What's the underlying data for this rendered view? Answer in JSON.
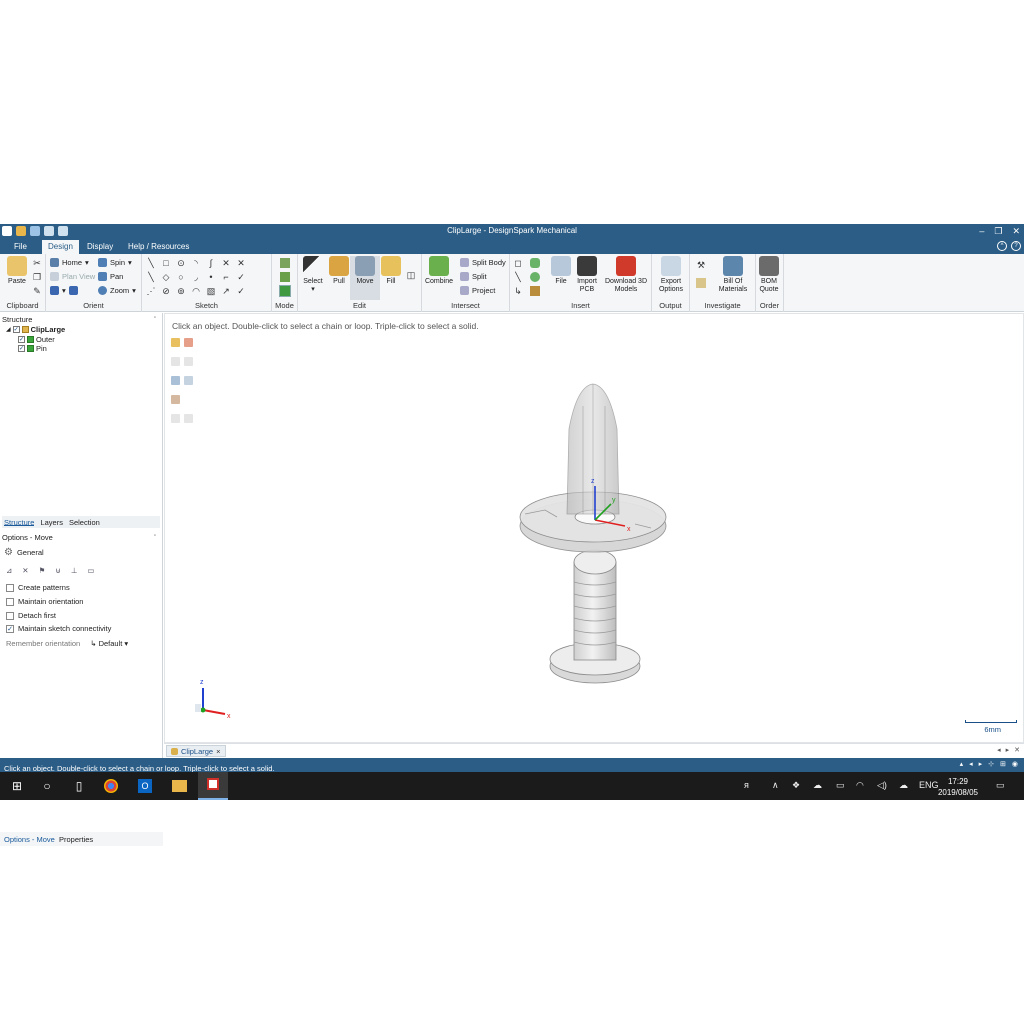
{
  "window": {
    "title": "ClipLarge - DesignSpark Mechanical",
    "controls": [
      "–",
      "❐",
      "✕"
    ]
  },
  "menu": {
    "tabs": [
      {
        "label": "File",
        "active": false
      },
      {
        "label": "Design",
        "active": true
      },
      {
        "label": "Display",
        "active": false
      },
      {
        "label": "Help / Resources",
        "active": false
      }
    ]
  },
  "ribbon": {
    "clipboard": {
      "paste": "Paste",
      "group": "Clipboard"
    },
    "orient": {
      "home": "Home",
      "plan_view": "Plan View",
      "spin": "Spin",
      "pan": "Pan",
      "zoom": "Zoom",
      "group": "Orient"
    },
    "sketch": {
      "group": "Sketch"
    },
    "mode": {
      "group": "Mode"
    },
    "edit": {
      "select": "Select",
      "pull": "Pull",
      "move": "Move",
      "fill": "Fill",
      "group": "Edit"
    },
    "intersect": {
      "combine": "Combine",
      "split_body": "Split Body",
      "split": "Split",
      "project": "Project",
      "group": "Intersect"
    },
    "insert": {
      "file": "File",
      "import_pcb": "Import PCB",
      "download_3d": "Download 3D Models",
      "group": "Insert"
    },
    "output": {
      "export": "Export Options",
      "group": "Output"
    },
    "investigate": {
      "bom": "Bill Of Materials",
      "group": "Investigate"
    },
    "order": {
      "bom_quote": "BOM Quote",
      "group": "Order"
    }
  },
  "structure": {
    "header": "Structure",
    "tree": [
      {
        "label": "ClipLarge",
        "bold": true,
        "level": 0
      },
      {
        "label": "Outer",
        "bold": false,
        "level": 1
      },
      {
        "label": "Pin",
        "bold": false,
        "level": 1
      }
    ],
    "tabs": [
      "Structure",
      "Layers",
      "Selection"
    ]
  },
  "options": {
    "header": "Options - Move",
    "section": "General",
    "checkboxes": [
      {
        "label": "Create patterns",
        "checked": false
      },
      {
        "label": "Maintain orientation",
        "checked": false
      },
      {
        "label": "Detach first",
        "checked": false
      },
      {
        "label": "Maintain sketch connectivity",
        "checked": true
      }
    ],
    "remember_label": "Remember orientation",
    "remember_value": "Default"
  },
  "bottom_tabs": [
    "Options - Move",
    "Properties"
  ],
  "viewport": {
    "hint": "Click an object.  Double-click to select a chain or loop.  Triple-click to select a solid.",
    "scale": "6mm",
    "axes": {
      "x": "x",
      "y": "y",
      "z": "z"
    }
  },
  "doc_tab": {
    "label": "ClipLarge",
    "close": "×"
  },
  "statusbar": {
    "text": "Click an object.  Double-click to select a chain or loop.  Triple-click to select a solid."
  },
  "taskbar": {
    "lang": "ENG",
    "time": "17:29",
    "date": "2019/08/05"
  },
  "colors": {
    "titlebar": "#2b5d86",
    "ribbon": "#f4f6f8",
    "taskbar": "#1b1b1b",
    "axis_x": "#e02020",
    "axis_y": "#20a020",
    "axis_z": "#2040d0"
  }
}
